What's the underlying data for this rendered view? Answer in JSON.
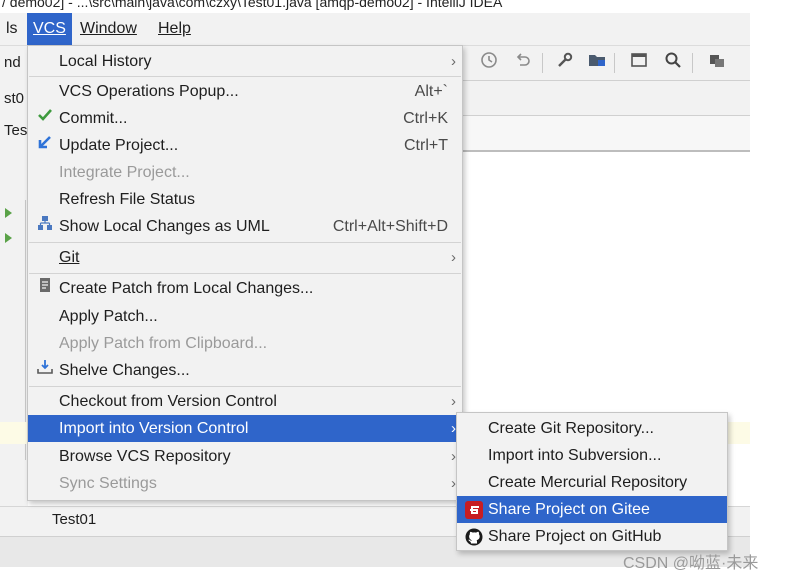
{
  "window": {
    "title": "/ demo02] - ...\\src\\main\\java\\com\\czxy\\Test01.java [amqp-demo02] - IntelliJ IDEA"
  },
  "menubar": {
    "items": [
      {
        "label": "ls"
      },
      {
        "label": "VCS"
      },
      {
        "label": "Window"
      },
      {
        "label": "Help"
      }
    ]
  },
  "left_strip": {
    "texts": [
      "nd",
      "st0",
      "Test"
    ]
  },
  "vcs_menu": {
    "items": [
      {
        "label": "Local History",
        "shortcut": "",
        "submenu": true
      },
      {
        "label": "VCS Operations Popup...",
        "shortcut": "Alt+`"
      },
      {
        "label": "Commit...",
        "shortcut": "Ctrl+K",
        "icon": "checkmark-icon"
      },
      {
        "label": "Update Project...",
        "shortcut": "Ctrl+T",
        "icon": "update-arrow-icon"
      },
      {
        "label": "Integrate Project...",
        "shortcut": "",
        "disabled": true
      },
      {
        "label": "Refresh File Status",
        "shortcut": ""
      },
      {
        "label": "Show Local Changes as UML",
        "shortcut": "Ctrl+Alt+Shift+D",
        "icon": "uml-icon"
      },
      {
        "label": "Git",
        "shortcut": "",
        "submenu": true
      },
      {
        "label": "Create Patch from Local Changes...",
        "shortcut": "",
        "icon": "patch-icon"
      },
      {
        "label": "Apply Patch...",
        "shortcut": ""
      },
      {
        "label": "Apply Patch from Clipboard...",
        "shortcut": "",
        "disabled": true
      },
      {
        "label": "Shelve Changes...",
        "shortcut": "",
        "icon": "shelve-icon"
      },
      {
        "label": "Checkout from Version Control",
        "shortcut": "",
        "submenu": true
      },
      {
        "label": "Import into Version Control",
        "shortcut": "",
        "submenu": true,
        "highlighted": true
      },
      {
        "label": "Browse VCS Repository",
        "shortcut": "",
        "submenu": true
      },
      {
        "label": "Sync Settings",
        "shortcut": "",
        "submenu": true,
        "disabled": true
      }
    ]
  },
  "import_submenu": {
    "items": [
      {
        "label": "Create Git Repository..."
      },
      {
        "label": "Import into Subversion..."
      },
      {
        "label": "Create Mercurial Repository"
      },
      {
        "label": "Share Project on Gitee",
        "icon": "gitee-icon",
        "highlighted": true
      },
      {
        "label": "Share Project on GitHub",
        "icon": "github-icon"
      }
    ]
  },
  "toolbar": {
    "icons": [
      "history-icon",
      "revert-icon",
      "wrench-icon",
      "project-structure-icon",
      "run-window-icon",
      "search-icon",
      "database-icon"
    ]
  },
  "bottom": {
    "label": "Test01"
  },
  "watermark": "CSDN @呦蓝·未来",
  "colors": {
    "menu_bg": "#f2f2f2",
    "highlight": "#2f65ca",
    "disabled_text": "#9a9a9a",
    "commit_check": "#3e9a3e",
    "update_arrow": "#2f73d8",
    "gitee_red": "#c71d23"
  }
}
